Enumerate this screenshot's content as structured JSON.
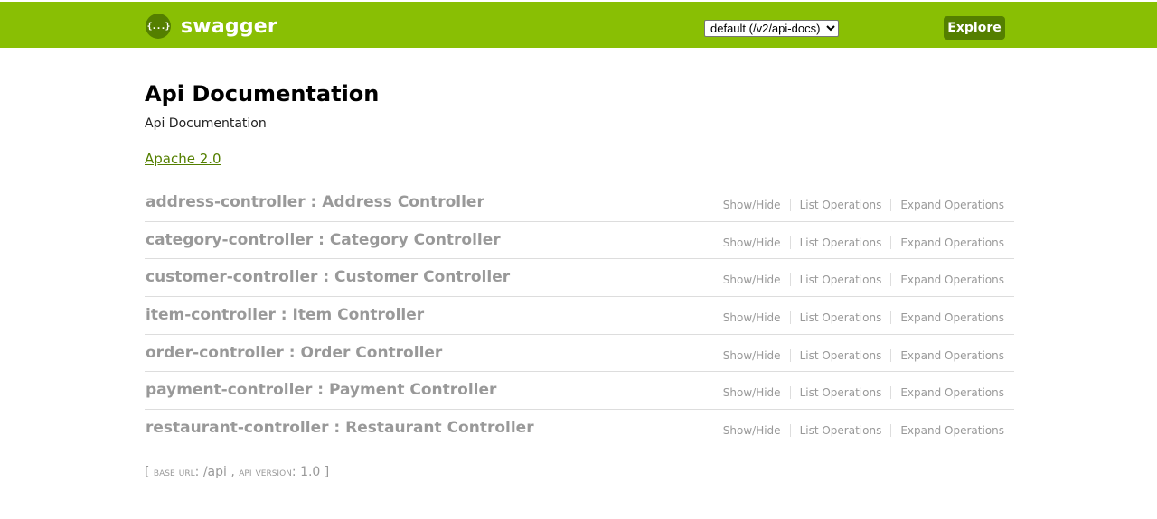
{
  "header": {
    "logo_icon": "{...}",
    "logo_text": "swagger",
    "spec_select": {
      "value": "default (/v2/api-docs)",
      "options": [
        "default (/v2/api-docs)"
      ]
    },
    "explore_label": "Explore",
    "brand_color": "#89bf04",
    "accent_color": "#547f00"
  },
  "info": {
    "title": "Api Documentation",
    "description": "Api Documentation",
    "license": "Apache 2.0"
  },
  "resources": [
    {
      "name": "address-controller : Address Controller"
    },
    {
      "name": "category-controller : Category Controller"
    },
    {
      "name": "customer-controller : Customer Controller"
    },
    {
      "name": "item-controller : Item Controller"
    },
    {
      "name": "order-controller : Order Controller"
    },
    {
      "name": "payment-controller : Payment Controller"
    },
    {
      "name": "restaurant-controller : Restaurant Controller"
    }
  ],
  "operations": {
    "show_hide": "Show/Hide",
    "list": "List Operations",
    "expand": "Expand Operations"
  },
  "footer": {
    "open_bracket": "[",
    "base_url_label": "base url",
    "base_url_value": "/api",
    "api_version_label": "api version",
    "api_version_value": "1.0",
    "close_bracket": "]"
  }
}
